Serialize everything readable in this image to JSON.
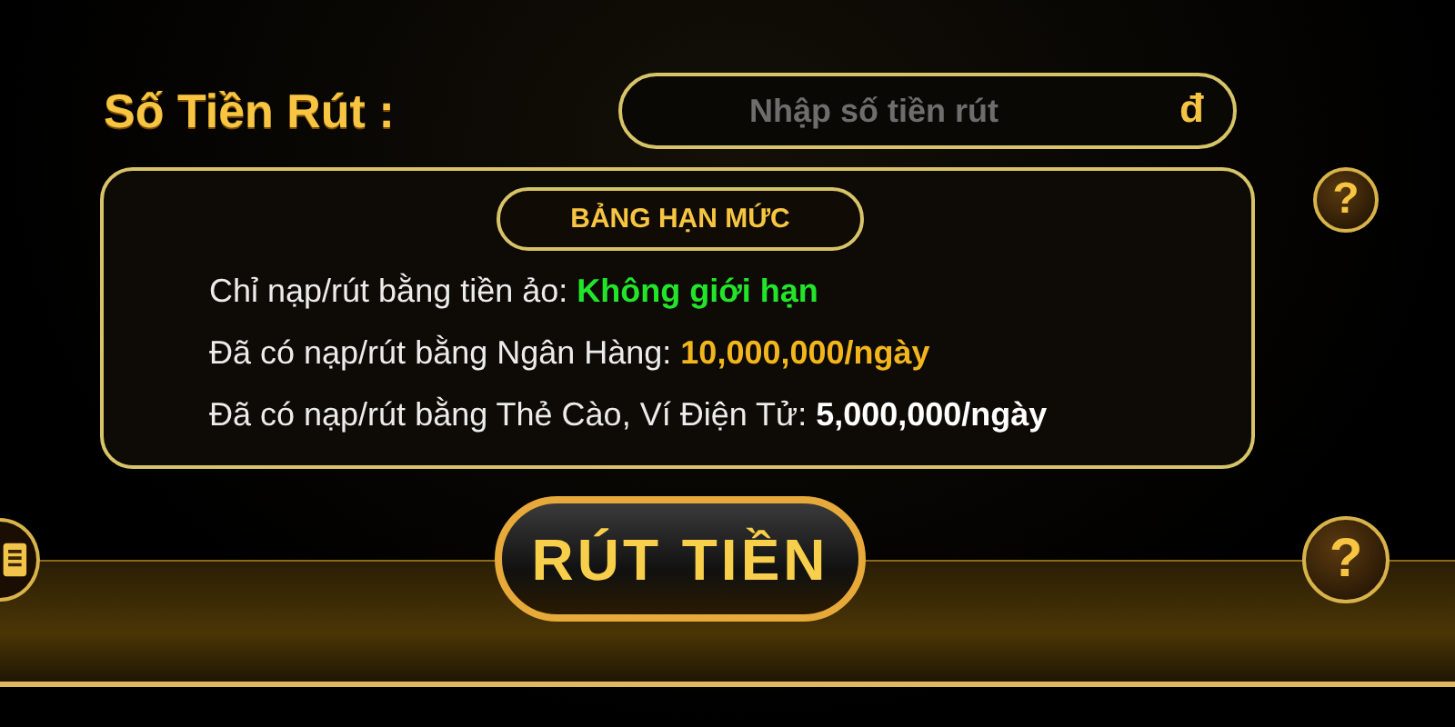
{
  "amount_label": "Số Tiền Rút :",
  "amount_field": {
    "placeholder": "Nhập số tiền rút",
    "currency": "đ"
  },
  "limit_table": {
    "title": "BẢNG HẠN MỨC",
    "help": "?",
    "rows": [
      {
        "label": "Chỉ nạp/rút bằng tiền ảo:",
        "value": "Không giới hạn",
        "color": "#22e52a"
      },
      {
        "label": "Đã có nạp/rút bằng Ngân Hàng:",
        "value": "10,000,000/ngày",
        "color": "#f2b51c"
      },
      {
        "label": "Đã có nạp/rút bằng Thẻ Cào, Ví Điện Tử:",
        "value": "5,000,000/ngày",
        "color": "#ffffff"
      }
    ]
  },
  "submit_button": "RÚT TIỀN",
  "bottom_help": "?"
}
